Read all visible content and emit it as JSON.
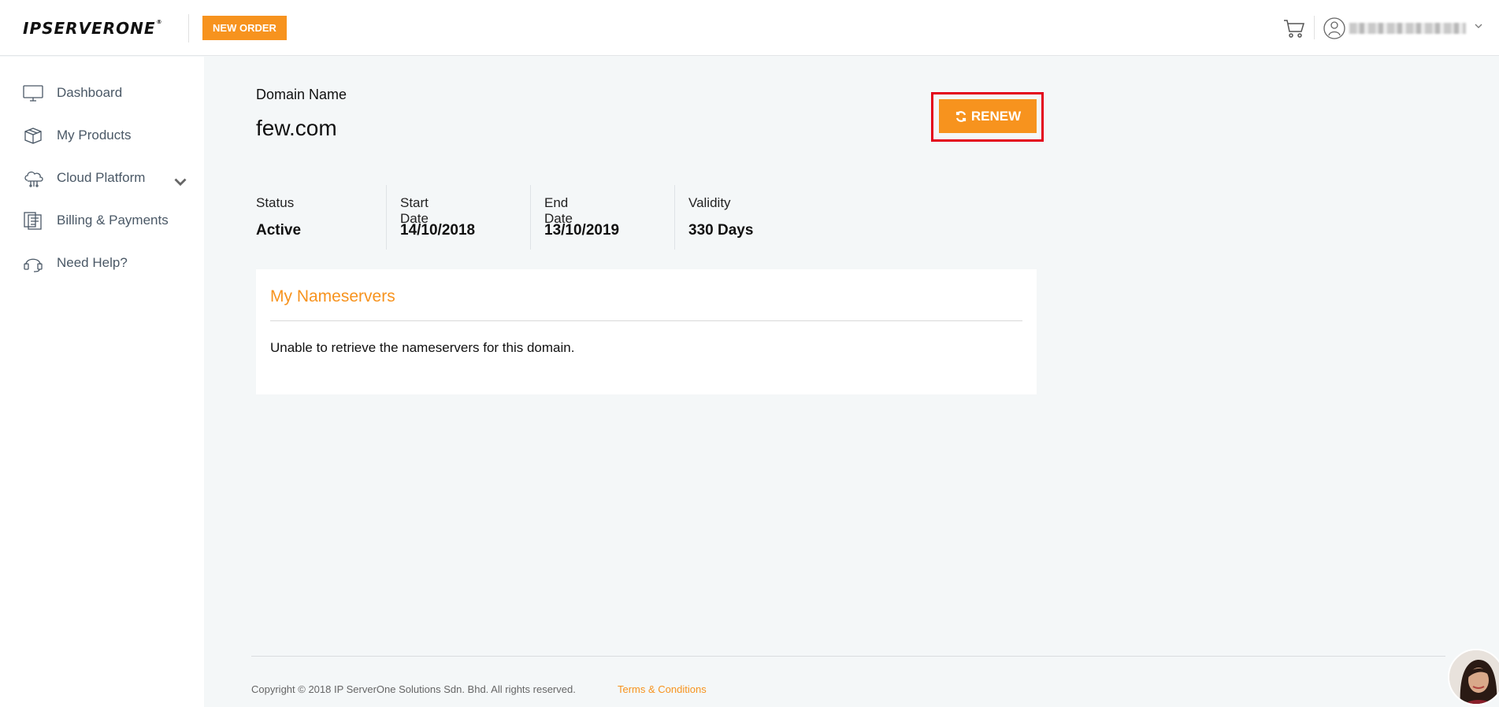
{
  "header": {
    "logo_text": "IPSERVERONE",
    "new_order_label": "NEW ORDER",
    "user_name_blurred": true
  },
  "sidebar": {
    "items": [
      {
        "label": "Dashboard",
        "icon": "monitor-icon"
      },
      {
        "label": "My Products",
        "icon": "box-icon"
      },
      {
        "label": "Cloud Platform",
        "icon": "cloud-icon",
        "has_submenu": true
      },
      {
        "label": "Billing & Payments",
        "icon": "invoice-icon"
      },
      {
        "label": "Need Help?",
        "icon": "headset-icon"
      }
    ]
  },
  "domain": {
    "title": "Domain Name",
    "name": "few.com",
    "renew_label": "RENEW"
  },
  "stats": [
    {
      "label": "Status",
      "value": "Active"
    },
    {
      "label": "Start Date",
      "value": "14/10/2018"
    },
    {
      "label": "End Date",
      "value": "13/10/2019"
    },
    {
      "label": "Validity",
      "value": "330 Days"
    }
  ],
  "nameservers": {
    "title": "My Nameservers",
    "message": "Unable to retrieve the nameservers for this domain."
  },
  "footer": {
    "copyright": "Copyright © 2018 IP ServerOne Solutions Sdn. Bhd. All rights reserved.",
    "terms_link": "Terms & Conditions"
  },
  "colors": {
    "accent": "#f7931e",
    "highlight": "#e3001b",
    "page_bg": "#f4f7f8"
  }
}
